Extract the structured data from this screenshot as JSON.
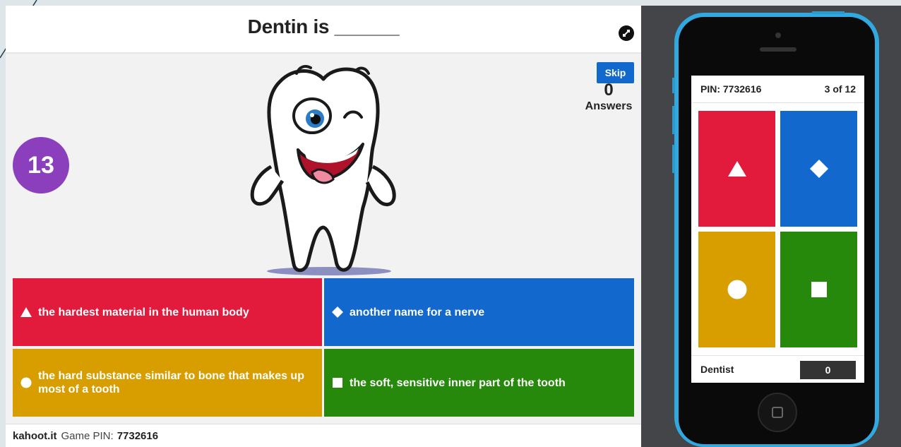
{
  "question": {
    "text": "Dentin is ______"
  },
  "timer": {
    "value": "13"
  },
  "skip": {
    "label": "Skip"
  },
  "answers_info": {
    "count": "0",
    "label": "Answers"
  },
  "choices": [
    {
      "shape": "triangle-icon",
      "text": "the hardest material in the human body",
      "color": "#e21b3c"
    },
    {
      "shape": "diamond-icon",
      "text": "another name for a nerve",
      "color": "#1368ce"
    },
    {
      "shape": "circle-icon",
      "text": "the hard substance similar to bone that makes up most of a tooth",
      "color": "#d89e00"
    },
    {
      "shape": "square-icon",
      "text": "the soft, sensitive inner part of the tooth",
      "color": "#26890c"
    }
  ],
  "footer": {
    "site": "kahoot.it",
    "pin_label": "Game PIN:",
    "pin": "7732616"
  },
  "phone": {
    "pin": "PIN: 7732616",
    "progress": "3 of 12",
    "player_name": "Dentist",
    "score": "0"
  },
  "colors": {
    "purple": "#8b3fbd",
    "phone_frame": "#31a9e0",
    "panel": "#444548"
  }
}
